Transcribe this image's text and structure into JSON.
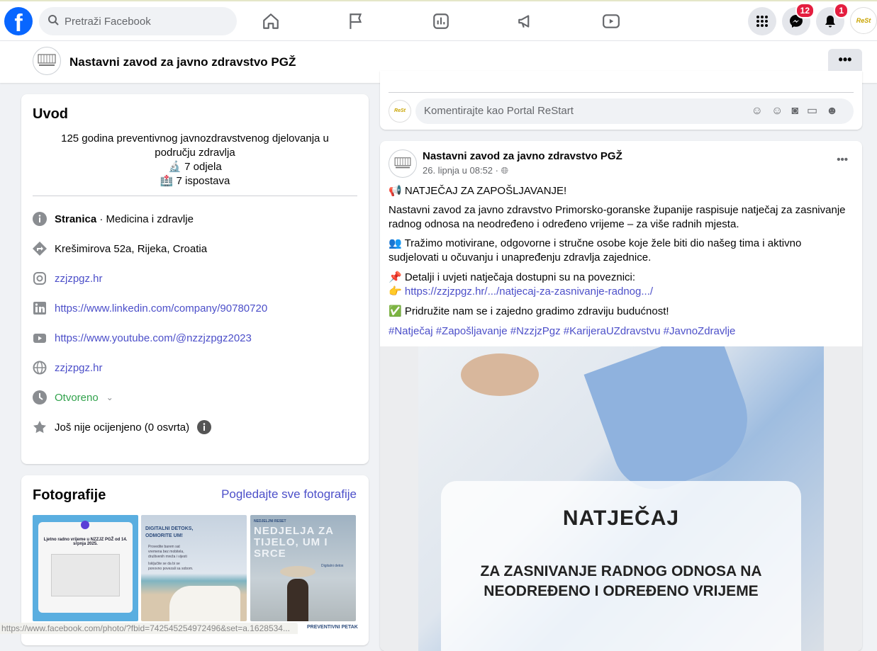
{
  "topbar": {
    "search_placeholder": "Pretraži Facebook",
    "messenger_badge": "12",
    "notifications_badge": "1"
  },
  "page": {
    "name": "Nastavni zavod za javno zdravstvo PGŽ",
    "more": "•••"
  },
  "intro": {
    "title": "Uvod",
    "bio_line": "125 godina preventivnog javnozdravstvenog djelovanja u području zdravlja",
    "departments": "7 odjela",
    "branches": "7 ispostava",
    "category_bold": "Stranica",
    "category": " · Medicina i zdravlje",
    "address": "Krešimirova 52a, Rijeka, Croatia",
    "instagram": "zzjzpgz.hr",
    "linkedin": "https://www.linkedin.com/company/90780720",
    "youtube": "https://www.youtube.com/@nzzjzpgz2023",
    "website": "zzjzpgz.hr",
    "hours": "Otvoreno",
    "rating": "Još nije ocijenjeno (0 osvrta)"
  },
  "photos": {
    "title": "Fotografije",
    "see_all": "Pogledajte sve fotografije",
    "p1": "Ljetno radno vrijeme u NZZJZ PGŽ od 14. srpnja 2025.",
    "p2_title": "DIGITALNI DETOKS, ODMORITE UM!",
    "p2_b1": "Provedite barem sat vremena bez mobitela, društvenih mreža i vijesti",
    "p2_b2": "Isključite se da bi se ponovno povezali sa sobom.",
    "p3_small": "NEDJELJNI RESET",
    "p3_big": "NEDJELJA ZA TIJELO, UM I SRCE",
    "p3_link": "Digitalni detox",
    "p4": "PREVENTIVNI PETAK"
  },
  "comment": {
    "placeholder": "Komentirajte kao Portal ReStart"
  },
  "post": {
    "author": "Nastavni zavod za javno zdravstvo PGŽ",
    "date": "26. lipnja u 08:52 · ",
    "more": "•••",
    "p1": "📢 NATJEČAJ ZA ZAPOŠLJAVANJE!",
    "p2": "Nastavni zavod za javno zdravstvo Primorsko-goranske županije raspisuje natječaj za zasnivanje radnog odnosa na neodređeno i određeno vrijeme – za više radnih mjesta.",
    "p3": "👥 Tražimo motivirane, odgovorne i stručne osobe koje žele biti dio našeg tima i aktivno sudjelovati u očuvanju i unapređenju zdravlja zajednice.",
    "p4": "📌 Detalji i uvjeti natječaja dostupni su na poveznici:",
    "p5_emoji": "👉 ",
    "link": "https://zzjzpgz.hr/.../natjecaj-za-zasnivanje-radnog.../",
    "p6": "✅ Pridružite nam se i zajedno gradimo zdraviju budućnost!",
    "hashtags": "#Natječaj #Zapošljavanje #NzzjzPgz #KarijeraUZdravstvu #JavnoZdravlje",
    "image_title": "NATJEČAJ",
    "image_sub": "ZA ZASNIVANJE RADNOG ODNOSA NA NEODREĐENO I ODREĐENO VRIJEME"
  },
  "status_url": "https://www.facebook.com/photo/?fbid=742545254972496&set=a.1628534..."
}
